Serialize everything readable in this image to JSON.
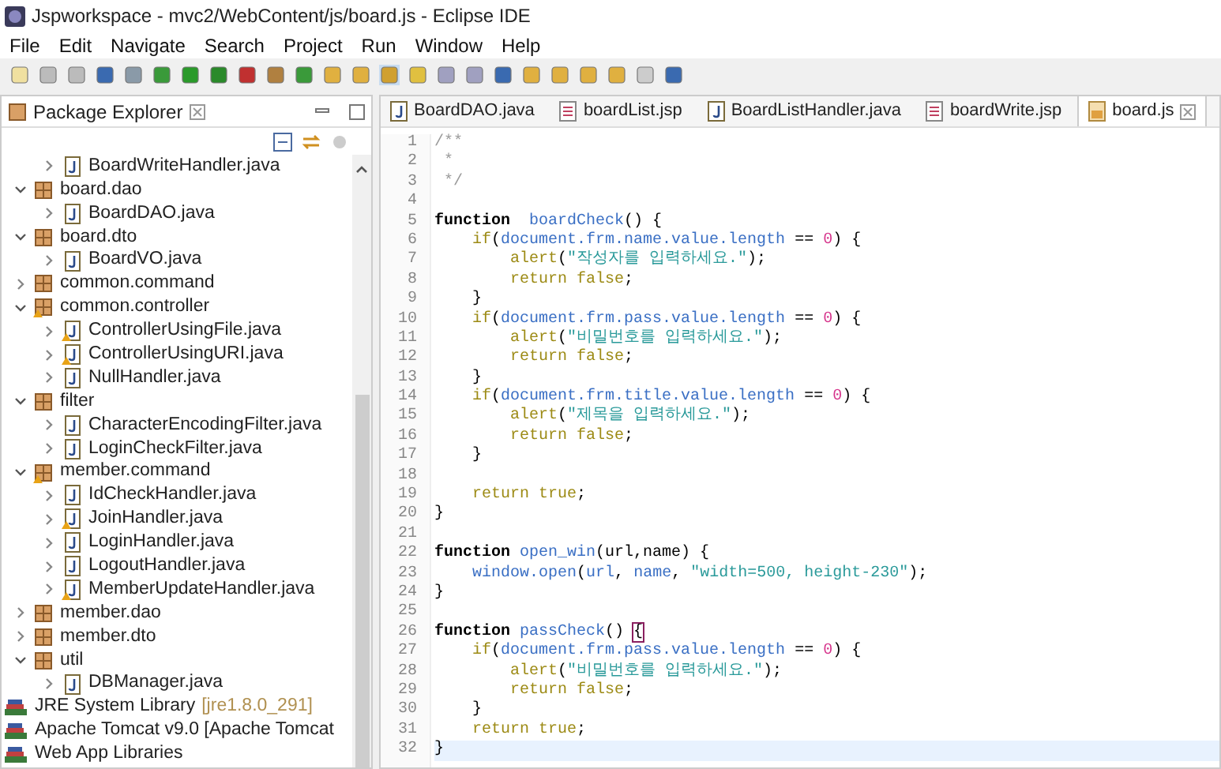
{
  "window": {
    "title": "Jspworkspace - mvc2/WebContent/js/board.js - Eclipse IDE"
  },
  "menu": [
    "File",
    "Edit",
    "Navigate",
    "Search",
    "Project",
    "Run",
    "Window",
    "Help"
  ],
  "explorer": {
    "title": "Package Explorer",
    "tree": [
      {
        "children": [
          {
            "children": [
              {
                "label": "BoardWriteHandler.java",
                "kind": "file",
                "expanded": false,
                "warning": false
              }
            ]
          },
          {
            "label": "board.dao",
            "kind": "package",
            "expanded": true,
            "warning": false,
            "children": [
              {
                "label": "BoardDAO.java",
                "kind": "file",
                "expanded": false,
                "warning": false
              }
            ]
          },
          {
            "label": "board.dto",
            "kind": "package",
            "expanded": true,
            "warning": false,
            "children": [
              {
                "label": "BoardVO.java",
                "kind": "file",
                "expanded": false,
                "warning": false
              }
            ]
          },
          {
            "label": "common.command",
            "kind": "package",
            "expanded": false,
            "warning": false
          },
          {
            "label": "common.controller",
            "kind": "package",
            "expanded": true,
            "warning": true,
            "children": [
              {
                "label": "ControllerUsingFile.java",
                "kind": "file",
                "expanded": false,
                "warning": true
              },
              {
                "label": "ControllerUsingURI.java",
                "kind": "file",
                "expanded": false,
                "warning": true
              },
              {
                "label": "NullHandler.java",
                "kind": "file",
                "expanded": false,
                "warning": false
              }
            ]
          },
          {
            "label": "filter",
            "kind": "package",
            "expanded": true,
            "warning": false,
            "children": [
              {
                "label": "CharacterEncodingFilter.java",
                "kind": "file",
                "expanded": false,
                "warning": false
              },
              {
                "label": "LoginCheckFilter.java",
                "kind": "file",
                "expanded": false,
                "warning": false
              }
            ]
          },
          {
            "label": "member.command",
            "kind": "package",
            "expanded": true,
            "warning": true,
            "children": [
              {
                "label": "IdCheckHandler.java",
                "kind": "file",
                "expanded": false,
                "warning": false
              },
              {
                "label": "JoinHandler.java",
                "kind": "file",
                "expanded": false,
                "warning": true
              },
              {
                "label": "LoginHandler.java",
                "kind": "file",
                "expanded": false,
                "warning": false
              },
              {
                "label": "LogoutHandler.java",
                "kind": "file",
                "expanded": false,
                "warning": false
              },
              {
                "label": "MemberUpdateHandler.java",
                "kind": "file",
                "expanded": false,
                "warning": true
              }
            ]
          },
          {
            "label": "member.dao",
            "kind": "package",
            "expanded": false,
            "warning": false
          },
          {
            "label": "member.dto",
            "kind": "package",
            "expanded": false,
            "warning": false
          },
          {
            "label": "util",
            "kind": "package",
            "expanded": true,
            "warning": false,
            "children": [
              {
                "label": "DBManager.java",
                "kind": "file",
                "expanded": false,
                "warning": false
              }
            ]
          }
        ]
      },
      {
        "label": "JRE System Library",
        "detail": "[jre1.8.0_291]",
        "kind": "library",
        "expanded": false
      },
      {
        "label": "Apache Tomcat v9.0 [Apache Tomcat",
        "kind": "library",
        "expanded": false
      },
      {
        "label": "Web App Libraries",
        "kind": "library",
        "expanded": false
      }
    ]
  },
  "tabs": [
    {
      "label": "BoardDAO.java",
      "kind": "java",
      "selected": false
    },
    {
      "label": "boardList.jsp",
      "kind": "jsp",
      "selected": false
    },
    {
      "label": "BoardListHandler.java",
      "kind": "java",
      "selected": false
    },
    {
      "label": "boardWrite.jsp",
      "kind": "jsp",
      "selected": false
    },
    {
      "label": "board.js",
      "kind": "js",
      "selected": true
    }
  ],
  "editor": {
    "lines": [
      {
        "n": "1",
        "current": false,
        "tokens": [
          {
            "kind": "comment",
            "text": "/**"
          }
        ]
      },
      {
        "n": "2",
        "current": false,
        "tokens": [
          {
            "kind": "comment",
            "text": " *"
          }
        ]
      },
      {
        "n": "3",
        "current": false,
        "tokens": [
          {
            "kind": "comment",
            "text": " */"
          }
        ]
      },
      {
        "n": "4",
        "current": false
      },
      {
        "n": "5",
        "current": false,
        "tokens": [
          {
            "kind": "keyword",
            "text": "function"
          },
          {
            "kind": "name",
            "text": "  boardCheck"
          },
          {
            "kind": "plain",
            "text": "() {"
          }
        ]
      },
      {
        "n": "6",
        "current": false,
        "tokens": [
          {
            "kind": "control",
            "text": "    if"
          },
          {
            "kind": "plain",
            "text": "("
          },
          {
            "kind": "name",
            "text": "document.frm.name.value.length"
          },
          {
            "kind": "plain",
            "text": " == "
          },
          {
            "kind": "number",
            "text": "0"
          },
          {
            "kind": "plain",
            "text": ") {"
          }
        ]
      },
      {
        "n": "7",
        "current": false,
        "tokens": [
          {
            "kind": "control",
            "text": "        alert"
          },
          {
            "kind": "plain",
            "text": "("
          },
          {
            "kind": "string",
            "text": "\"작성자를 입력하세요.\""
          },
          {
            "kind": "plain",
            "text": ");"
          }
        ]
      },
      {
        "n": "8",
        "current": false,
        "tokens": [
          {
            "kind": "control",
            "text": "        return false"
          },
          {
            "kind": "plain",
            "text": ";"
          }
        ]
      },
      {
        "n": "9",
        "current": false,
        "tokens": [
          {
            "kind": "plain",
            "text": "    }"
          }
        ]
      },
      {
        "n": "10",
        "current": false,
        "tokens": [
          {
            "kind": "control",
            "text": "    if"
          },
          {
            "kind": "plain",
            "text": "("
          },
          {
            "kind": "name",
            "text": "document.frm.pass.value.length"
          },
          {
            "kind": "plain",
            "text": " == "
          },
          {
            "kind": "number",
            "text": "0"
          },
          {
            "kind": "plain",
            "text": ") {"
          }
        ]
      },
      {
        "n": "11",
        "current": false,
        "tokens": [
          {
            "kind": "control",
            "text": "        alert"
          },
          {
            "kind": "plain",
            "text": "("
          },
          {
            "kind": "string",
            "text": "\"비밀번호를 입력하세요.\""
          },
          {
            "kind": "plain",
            "text": ");"
          }
        ]
      },
      {
        "n": "12",
        "current": false,
        "tokens": [
          {
            "kind": "control",
            "text": "        return false"
          },
          {
            "kind": "plain",
            "text": ";"
          }
        ]
      },
      {
        "n": "13",
        "current": false,
        "tokens": [
          {
            "kind": "plain",
            "text": "    }"
          }
        ]
      },
      {
        "n": "14",
        "current": false,
        "tokens": [
          {
            "kind": "control",
            "text": "    if"
          },
          {
            "kind": "plain",
            "text": "("
          },
          {
            "kind": "name",
            "text": "document.frm.title.value.length"
          },
          {
            "kind": "plain",
            "text": " == "
          },
          {
            "kind": "number",
            "text": "0"
          },
          {
            "kind": "plain",
            "text": ") {"
          }
        ]
      },
      {
        "n": "15",
        "current": false,
        "tokens": [
          {
            "kind": "control",
            "text": "        alert"
          },
          {
            "kind": "plain",
            "text": "("
          },
          {
            "kind": "string",
            "text": "\"제목을 입력하세요.\""
          },
          {
            "kind": "plain",
            "text": ");"
          }
        ]
      },
      {
        "n": "16",
        "current": false,
        "tokens": [
          {
            "kind": "control",
            "text": "        return false"
          },
          {
            "kind": "plain",
            "text": ";"
          }
        ]
      },
      {
        "n": "17",
        "current": false,
        "tokens": [
          {
            "kind": "plain",
            "text": "    }"
          }
        ]
      },
      {
        "n": "18",
        "current": false
      },
      {
        "n": "19",
        "current": false,
        "tokens": [
          {
            "kind": "control",
            "text": "    return true"
          },
          {
            "kind": "plain",
            "text": ";"
          }
        ]
      },
      {
        "n": "20",
        "current": false,
        "tokens": [
          {
            "kind": "plain",
            "text": "}"
          }
        ]
      },
      {
        "n": "21",
        "current": false
      },
      {
        "n": "22",
        "current": false,
        "tokens": [
          {
            "kind": "keyword",
            "text": "function"
          },
          {
            "kind": "name",
            "text": " open_win"
          },
          {
            "kind": "plain",
            "text": "(url,name) {"
          }
        ]
      },
      {
        "n": "23",
        "current": false,
        "tokens": [
          {
            "kind": "name",
            "text": "    window.open"
          },
          {
            "kind": "plain",
            "text": "("
          },
          {
            "kind": "name",
            "text": "url"
          },
          {
            "kind": "plain",
            "text": ", "
          },
          {
            "kind": "name",
            "text": "name"
          },
          {
            "kind": "plain",
            "text": ", "
          },
          {
            "kind": "string",
            "text": "\"width=500, height-230\""
          },
          {
            "kind": "plain",
            "text": ");"
          }
        ]
      },
      {
        "n": "24",
        "current": false,
        "tokens": [
          {
            "kind": "plain",
            "text": "}"
          }
        ]
      },
      {
        "n": "25",
        "current": false
      },
      {
        "n": "26",
        "current": false,
        "tokens": [
          {
            "kind": "keyword",
            "text": "function"
          },
          {
            "kind": "name",
            "text": " passCheck"
          },
          {
            "kind": "plain",
            "text": "() "
          },
          {
            "kind": "match",
            "text": "{"
          }
        ]
      },
      {
        "n": "27",
        "current": false,
        "tokens": [
          {
            "kind": "control",
            "text": "    if"
          },
          {
            "kind": "plain",
            "text": "("
          },
          {
            "kind": "name",
            "text": "document.frm.pass.value.length"
          },
          {
            "kind": "plain",
            "text": " == "
          },
          {
            "kind": "number",
            "text": "0"
          },
          {
            "kind": "plain",
            "text": ") {"
          }
        ]
      },
      {
        "n": "28",
        "current": false,
        "tokens": [
          {
            "kind": "control",
            "text": "        alert"
          },
          {
            "kind": "plain",
            "text": "("
          },
          {
            "kind": "string",
            "text": "\"비밀번호를 입력하세요.\""
          },
          {
            "kind": "plain",
            "text": ");"
          }
        ]
      },
      {
        "n": "29",
        "current": false,
        "tokens": [
          {
            "kind": "control",
            "text": "        return false"
          },
          {
            "kind": "plain",
            "text": ";"
          }
        ]
      },
      {
        "n": "30",
        "current": false,
        "tokens": [
          {
            "kind": "plain",
            "text": "    }"
          }
        ]
      },
      {
        "n": "31",
        "current": false,
        "tokens": [
          {
            "kind": "control",
            "text": "    return true"
          },
          {
            "kind": "plain",
            "text": ";"
          }
        ]
      },
      {
        "n": "32",
        "current": true,
        "tokens": [
          {
            "kind": "plain",
            "text": "}"
          }
        ]
      }
    ]
  }
}
